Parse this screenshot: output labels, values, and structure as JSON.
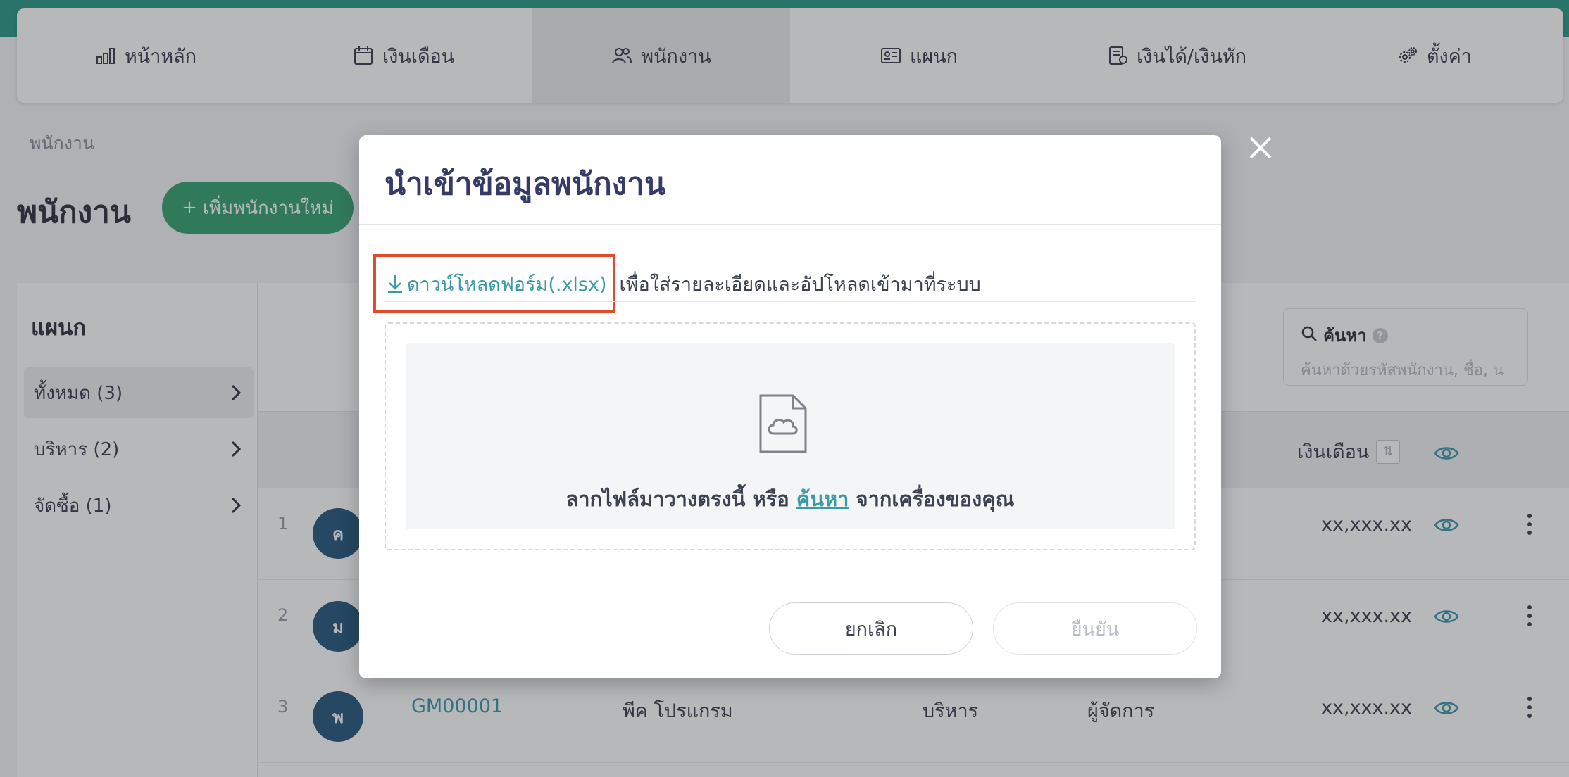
{
  "nav": {
    "items": [
      {
        "label": "หน้าหลัก",
        "icon": "bar-chart-icon"
      },
      {
        "label": "เงินเดือน",
        "icon": "calendar-icon"
      },
      {
        "label": "พนักงาน",
        "icon": "users-icon"
      },
      {
        "label": "แผนก",
        "icon": "id-card-icon"
      },
      {
        "label": "เงินได้/เงินหัก",
        "icon": "ledger-icon"
      },
      {
        "label": "ตั้งค่า",
        "icon": "gears-icon"
      }
    ],
    "active_index": 2
  },
  "breadcrumb": "พนักงาน",
  "page": {
    "title": "พนักงาน",
    "add_button": "เพิ่มพนักงานใหม่",
    "add_button_icon": "+"
  },
  "departments": {
    "title": "แผนก",
    "items": [
      {
        "label": "ทั้งหมด (3)"
      },
      {
        "label": "บริหาร (2)"
      },
      {
        "label": "จัดซื้อ (1)"
      }
    ]
  },
  "search": {
    "label": "ค้นหา",
    "help": "?",
    "placeholder": "ค้นหาด้วยรหัสพนักงาน, ชื่อ, น"
  },
  "table": {
    "salary_header": "เงินเดือน",
    "sort_icon": "⇅",
    "rows": [
      {
        "num": "1",
        "avatar": "ค",
        "code": "",
        "name": "",
        "dept": "",
        "position": "",
        "salary": "xx,xxx.xx"
      },
      {
        "num": "2",
        "avatar": "ม",
        "code": "",
        "name": "",
        "dept": "",
        "position": "",
        "salary": "xx,xxx.xx"
      },
      {
        "num": "3",
        "avatar": "พ",
        "code": "GM00001",
        "name": "พีค โปรแกรม",
        "dept": "บริหาร",
        "position": "ผู้จัดการ",
        "salary": "xx,xxx.xx"
      }
    ]
  },
  "modal": {
    "title": "นำเข้าข้อมูลพนักงาน",
    "download_link": "ดาวน์โหลดฟอร์ม(.xlsx)",
    "download_hint": "เพื่อใส่รายละเอียดและอัปโหลดเข้ามาที่ระบบ",
    "drop_text_before": "ลากไฟล์มาวางตรงนี้ หรือ ",
    "drop_text_link": "ค้นหา",
    "drop_text_after": " จากเครื่องของคุณ",
    "cancel": "ยกเลิก",
    "confirm": "ยืนยัน"
  },
  "colors": {
    "brand": "#2e9a86",
    "accent": "#3b9aa8",
    "add_button": "#3aa374",
    "highlight_box": "#e04a2f",
    "avatar": "#2a5b7e"
  }
}
